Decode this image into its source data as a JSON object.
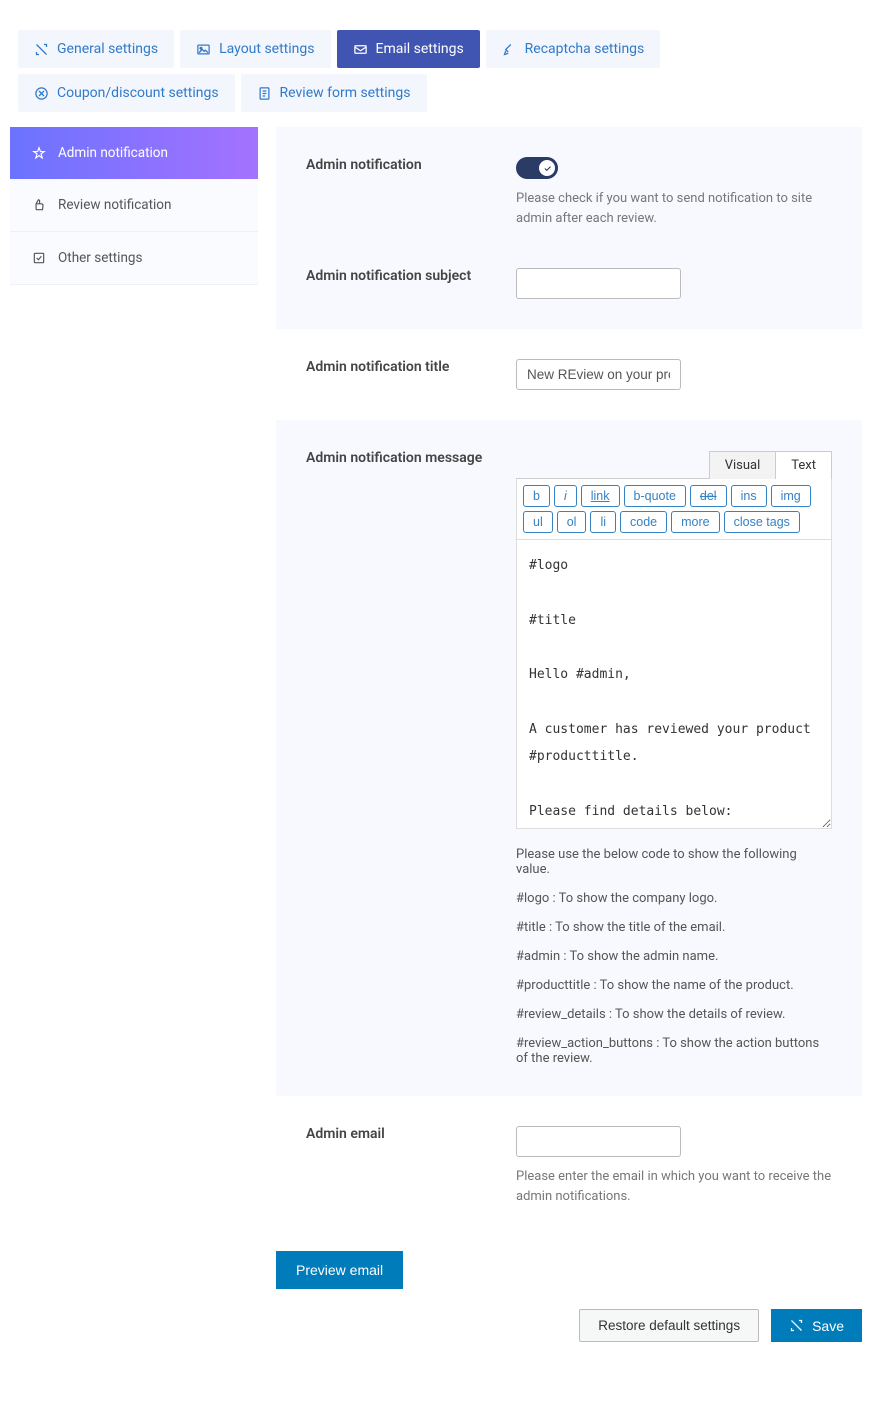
{
  "tabs": {
    "general": "General settings",
    "layout": "Layout settings",
    "email": "Email settings",
    "recaptcha": "Recaptcha settings",
    "coupon": "Coupon/discount settings",
    "reviewform": "Review form settings"
  },
  "sidebar": {
    "admin_notif": "Admin notification",
    "review_notif": "Review notification",
    "other": "Other settings"
  },
  "fields": {
    "admin_notif": {
      "label": "Admin notification",
      "help": "Please check if you want to send notification to site admin after each review."
    },
    "subject": {
      "label": "Admin notification subject",
      "value": ""
    },
    "title": {
      "label": "Admin notification title",
      "value": "New REview on your product"
    },
    "message": {
      "label": "Admin notification message"
    },
    "admin_email": {
      "label": "Admin email",
      "value": "",
      "help": "Please enter the email in which you want to receive the admin notifications."
    }
  },
  "editor": {
    "tabs": {
      "visual": "Visual",
      "text": "Text"
    },
    "buttons": {
      "b": "b",
      "i": "i",
      "link": "link",
      "bquote": "b-quote",
      "del": "del",
      "ins": "ins",
      "img": "img",
      "ul": "ul",
      "ol": "ol",
      "li": "li",
      "code": "code",
      "more": "more",
      "close": "close tags"
    },
    "content": "#logo\n\n#title\n\nHello #admin,\n\nA customer has reviewed your product #producttitle.\n\nPlease find details below:\n\n#productinfo\n\n#review_details"
  },
  "codes": {
    "intro": "Please use the below code to show the following value.",
    "logo": "#logo : To show the company logo.",
    "title": "#title : To show the title of the email.",
    "admin": "#admin : To show the admin name.",
    "producttitle": "#producttitle : To show the name of the product.",
    "review_details": "#review_details : To show the details of review.",
    "review_buttons": "#review_action_buttons : To show the action buttons of the review."
  },
  "buttons": {
    "preview": "Preview email",
    "restore": "Restore default settings",
    "save": "Save"
  }
}
